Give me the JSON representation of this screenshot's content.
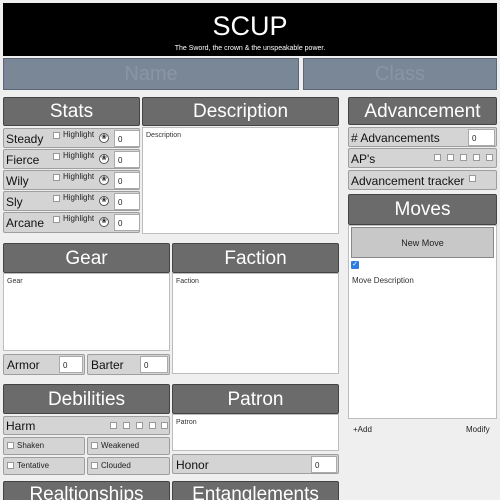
{
  "banner": {
    "title": "SCUP",
    "subtitle": "The Sword, the crown & the unspeakable power."
  },
  "identity": {
    "name_placeholder": "Name",
    "class_placeholder": "Class"
  },
  "stats": {
    "header": "Stats",
    "highlight_label": "Highlight",
    "items": [
      {
        "label": "Steady",
        "value": "0"
      },
      {
        "label": "Fierce",
        "value": "0"
      },
      {
        "label": "Wily",
        "value": "0"
      },
      {
        "label": "Sly",
        "value": "0"
      },
      {
        "label": "Arcane",
        "value": "0"
      }
    ]
  },
  "description": {
    "header": "Description",
    "placeholder": "Description"
  },
  "advancement": {
    "header": "Advancement",
    "advancements_label": "# Advancements",
    "advancements_value": "0",
    "aps_label": "AP's",
    "tracker_label": "Advancement tracker"
  },
  "moves": {
    "header": "Moves",
    "new_move_label": "New Move",
    "move_description": "Move Description",
    "add_label": "+Add",
    "modify_label": "Modify"
  },
  "gear": {
    "header": "Gear",
    "placeholder": "Gear",
    "armor_label": "Armor",
    "armor_value": "0",
    "barter_label": "Barter",
    "barter_value": "0"
  },
  "faction": {
    "header": "Faction",
    "placeholder": "Faction"
  },
  "debilities": {
    "header": "Debilities",
    "harm_label": "Harm",
    "conditions": [
      "Shaken",
      "Weakened",
      "Tentative",
      "Clouded"
    ]
  },
  "patron": {
    "header": "Patron",
    "placeholder": "Patron",
    "honor_label": "Honor",
    "honor_value": "0"
  },
  "bottom": {
    "relationships_header": "Realtionships",
    "entanglements_header": "Entanglements"
  }
}
